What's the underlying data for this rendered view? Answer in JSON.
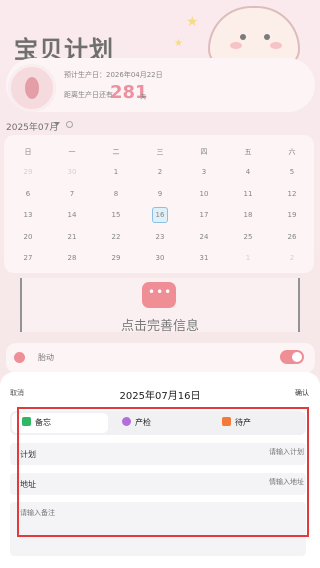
{
  "page": {
    "title": "宝贝计划",
    "due_date_text": "预计生产日：2026年04月22日",
    "countdown_prefix": "距离生产日还有",
    "countdown_value": "281",
    "countdown_unit": "天"
  },
  "calendar": {
    "month_label": "2025年07月",
    "weekdays": [
      "日",
      "一",
      "二",
      "三",
      "四",
      "五",
      "六"
    ],
    "weeks": [
      [
        {
          "d": "29",
          "m": true
        },
        {
          "d": "30",
          "m": true
        },
        {
          "d": "1"
        },
        {
          "d": "2"
        },
        {
          "d": "3"
        },
        {
          "d": "4"
        },
        {
          "d": "5"
        }
      ],
      [
        {
          "d": "6"
        },
        {
          "d": "7"
        },
        {
          "d": "8"
        },
        {
          "d": "9"
        },
        {
          "d": "10"
        },
        {
          "d": "11"
        },
        {
          "d": "12"
        }
      ],
      [
        {
          "d": "13"
        },
        {
          "d": "14"
        },
        {
          "d": "15"
        },
        {
          "d": "16",
          "s": true
        },
        {
          "d": "17"
        },
        {
          "d": "18"
        },
        {
          "d": "19"
        }
      ],
      [
        {
          "d": "20"
        },
        {
          "d": "21"
        },
        {
          "d": "22"
        },
        {
          "d": "23"
        },
        {
          "d": "24"
        },
        {
          "d": "25"
        },
        {
          "d": "26"
        }
      ],
      [
        {
          "d": "27"
        },
        {
          "d": "28"
        },
        {
          "d": "29"
        },
        {
          "d": "30"
        },
        {
          "d": "31"
        },
        {
          "d": "1",
          "m": true
        },
        {
          "d": "2",
          "m": true
        }
      ]
    ]
  },
  "info": {
    "prompt": "点击完善信息"
  },
  "fetal": {
    "label": "胎动",
    "enabled": true
  },
  "sheet": {
    "cancel": "取消",
    "date": "2025年07月16日",
    "confirm": "确认",
    "tabs": [
      {
        "label": "备忘",
        "icon": "memo-icon"
      },
      {
        "label": "产检",
        "icon": "checkup-icon"
      },
      {
        "label": "待产",
        "icon": "prep-icon"
      }
    ],
    "plan_label": "计划",
    "plan_placeholder": "请输入计划",
    "address_label": "地址",
    "address_placeholder": "情输入地址",
    "notes_placeholder": "请输入备注"
  },
  "colors": {
    "accent": "#e8525f",
    "highlight": "#e23a3a",
    "selected_day": "#4aa0d8"
  }
}
